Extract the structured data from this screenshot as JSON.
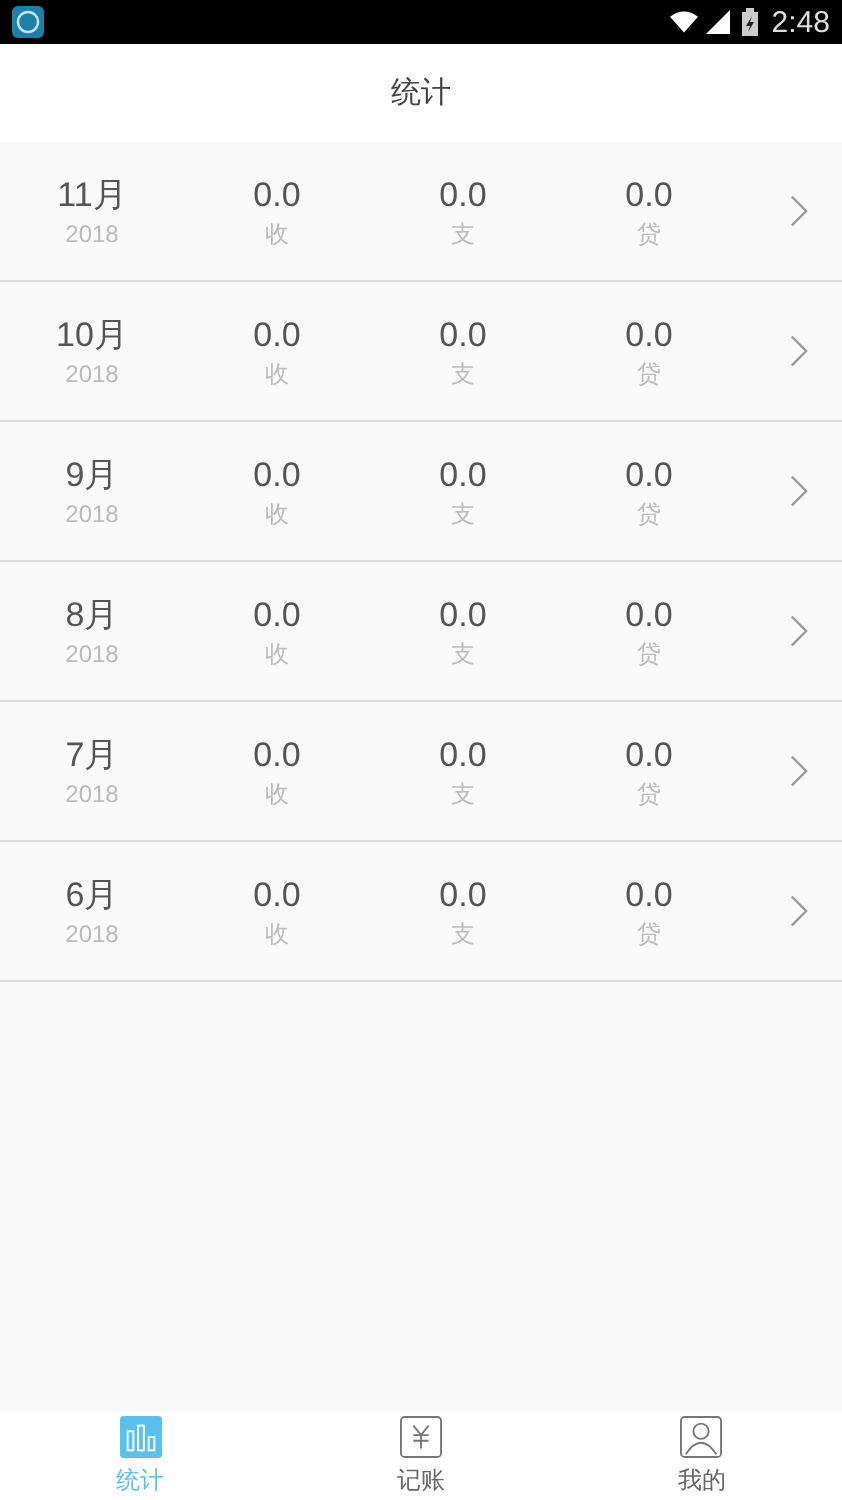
{
  "status_bar": {
    "time": "2:48"
  },
  "header": {
    "title": "统计"
  },
  "months": [
    {
      "month": "11月",
      "year": "2018",
      "values": [
        {
          "amount": "0.0",
          "label": "收"
        },
        {
          "amount": "0.0",
          "label": "支"
        },
        {
          "amount": "0.0",
          "label": "贷"
        }
      ]
    },
    {
      "month": "10月",
      "year": "2018",
      "values": [
        {
          "amount": "0.0",
          "label": "收"
        },
        {
          "amount": "0.0",
          "label": "支"
        },
        {
          "amount": "0.0",
          "label": "贷"
        }
      ]
    },
    {
      "month": "9月",
      "year": "2018",
      "values": [
        {
          "amount": "0.0",
          "label": "收"
        },
        {
          "amount": "0.0",
          "label": "支"
        },
        {
          "amount": "0.0",
          "label": "贷"
        }
      ]
    },
    {
      "month": "8月",
      "year": "2018",
      "values": [
        {
          "amount": "0.0",
          "label": "收"
        },
        {
          "amount": "0.0",
          "label": "支"
        },
        {
          "amount": "0.0",
          "label": "贷"
        }
      ]
    },
    {
      "month": "7月",
      "year": "2018",
      "values": [
        {
          "amount": "0.0",
          "label": "收"
        },
        {
          "amount": "0.0",
          "label": "支"
        },
        {
          "amount": "0.0",
          "label": "贷"
        }
      ]
    },
    {
      "month": "6月",
      "year": "2018",
      "values": [
        {
          "amount": "0.0",
          "label": "收"
        },
        {
          "amount": "0.0",
          "label": "支"
        },
        {
          "amount": "0.0",
          "label": "贷"
        }
      ]
    }
  ],
  "tabs": [
    {
      "kind": "chart",
      "label": "统计",
      "selected": true
    },
    {
      "kind": "money",
      "label": "记账",
      "selected": false
    },
    {
      "kind": "person",
      "label": "我的",
      "selected": false
    }
  ]
}
